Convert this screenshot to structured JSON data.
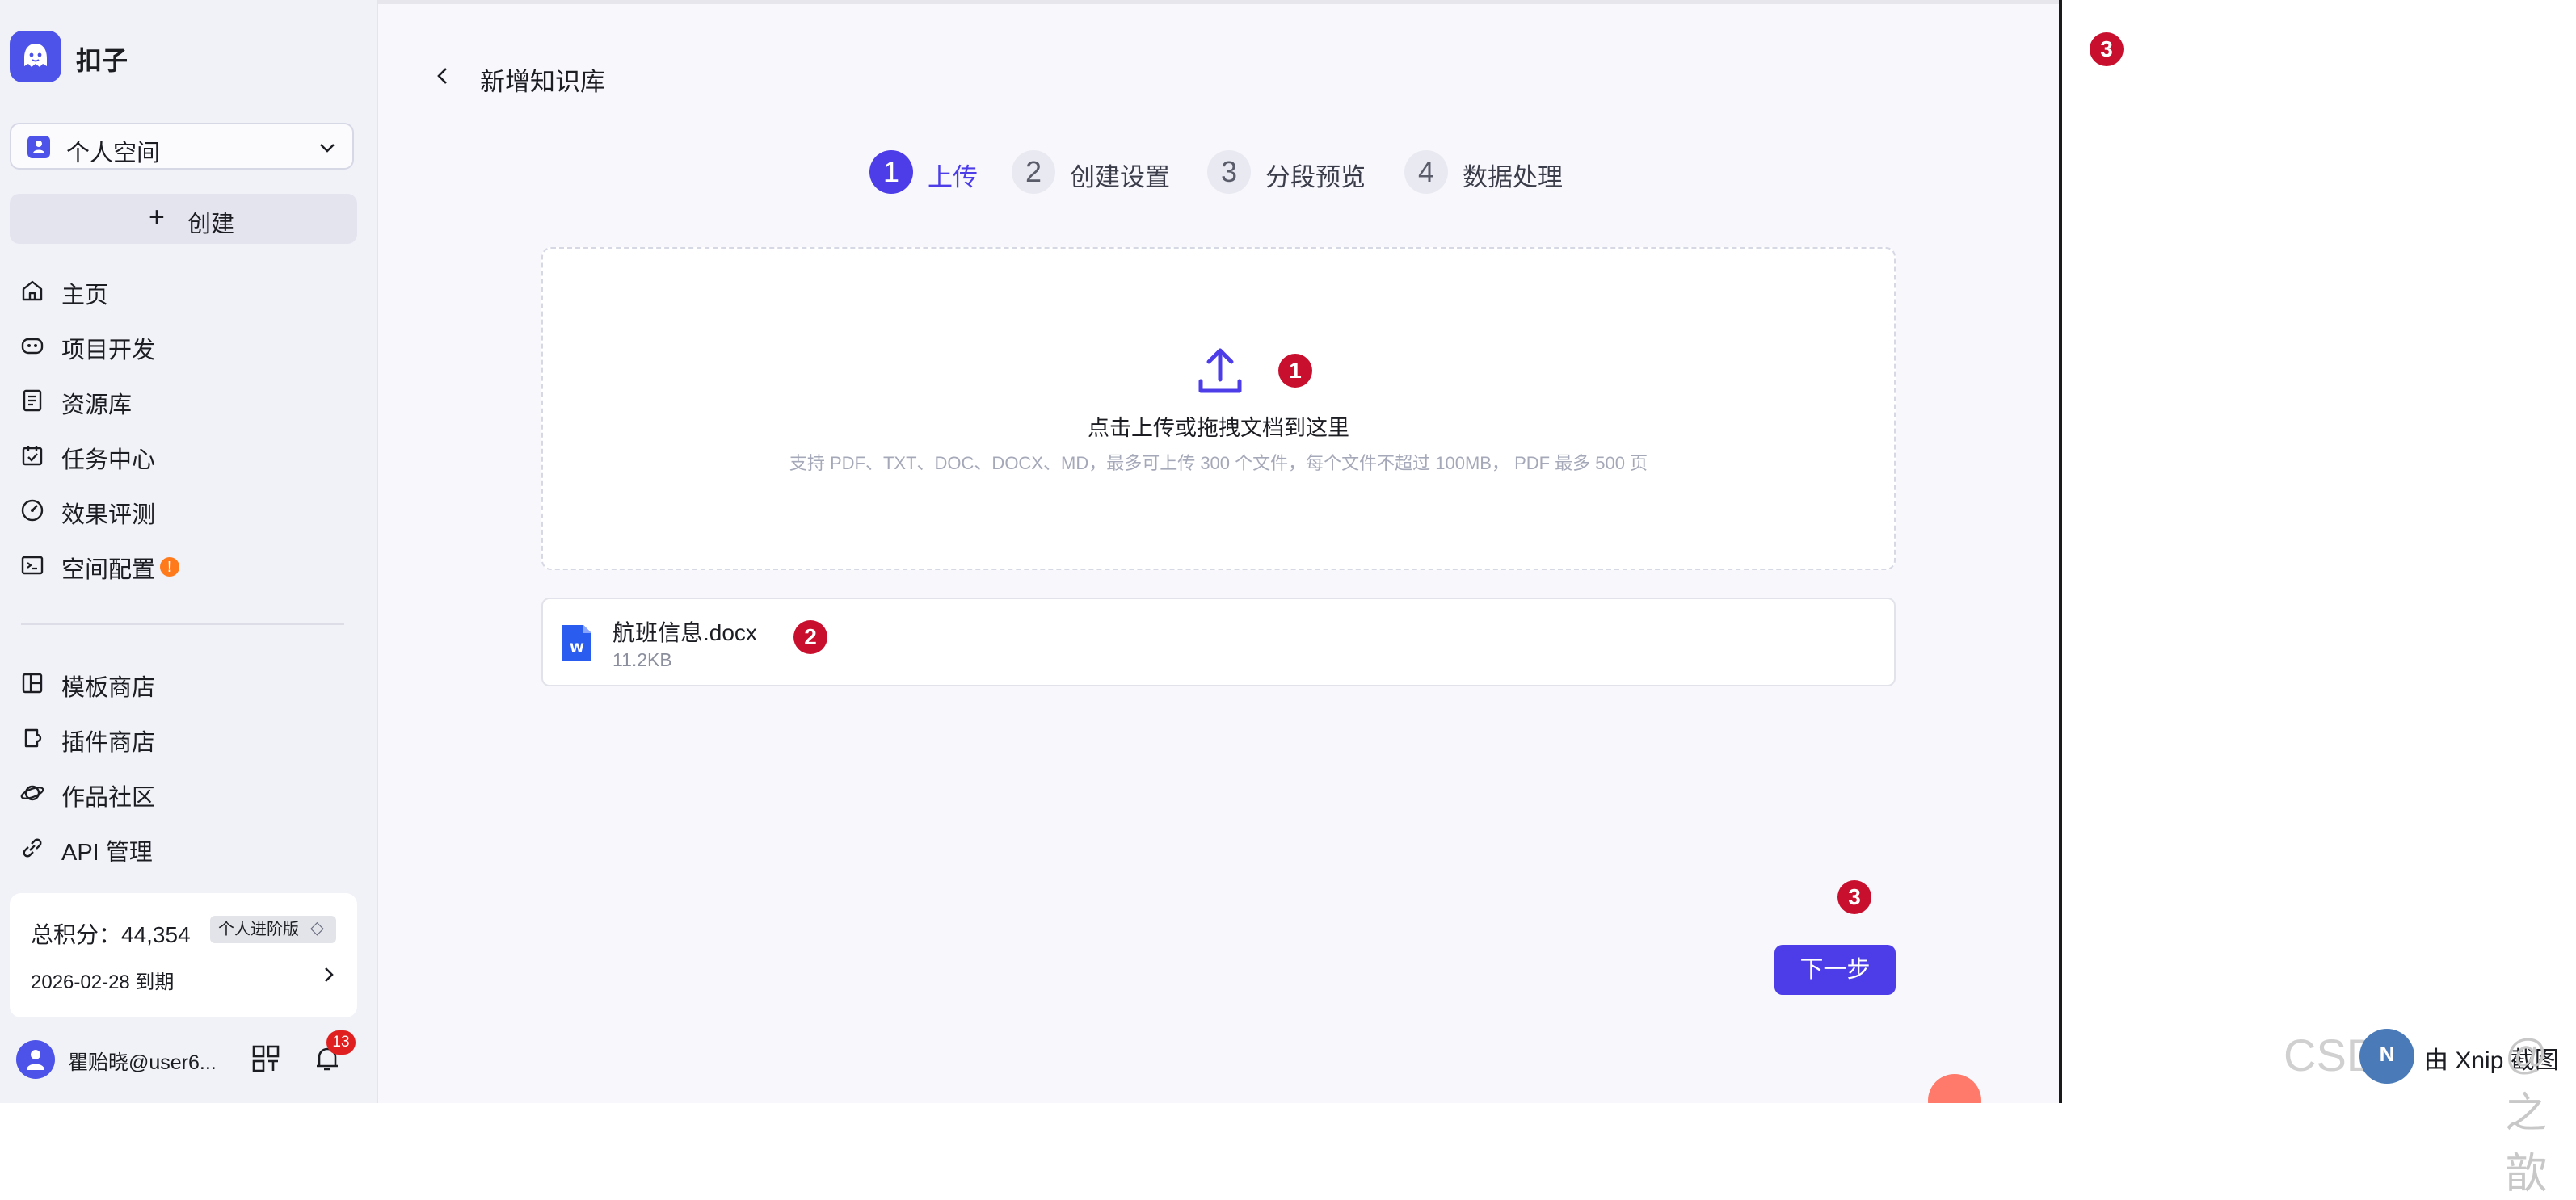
{
  "app": {
    "brand": "扣子",
    "space_selector": "个人空间",
    "create_label": "创建",
    "create_plus": "+"
  },
  "sidebar": {
    "items": [
      {
        "label": "主页",
        "icon": "home-icon"
      },
      {
        "label": "项目开发",
        "icon": "gamepad-icon"
      },
      {
        "label": "资源库",
        "icon": "library-icon"
      },
      {
        "label": "任务中心",
        "icon": "task-icon"
      },
      {
        "label": "效果评测",
        "icon": "gauge-icon"
      },
      {
        "label": "空间配置",
        "icon": "terminal-icon",
        "badge": "!"
      },
      {
        "label": "模板商店",
        "icon": "template-icon"
      },
      {
        "label": "插件商店",
        "icon": "plugin-icon"
      },
      {
        "label": "作品社区",
        "icon": "planet-icon"
      },
      {
        "label": "API 管理",
        "icon": "api-icon"
      }
    ],
    "points_label": "总积分：44,354",
    "plan_badge": "个人进阶版",
    "expiry": "2026-02-28 到期",
    "username": "瞿贻晓@user6...",
    "notification_count": "13"
  },
  "main": {
    "title": "新增知识库",
    "steps": [
      {
        "num": "1",
        "label": "上传",
        "active": true
      },
      {
        "num": "2",
        "label": "创建设置",
        "active": false
      },
      {
        "num": "3",
        "label": "分段预览",
        "active": false
      },
      {
        "num": "4",
        "label": "数据处理",
        "active": false
      }
    ],
    "upload": {
      "text": "点击上传或拖拽文档到这里",
      "hint": "支持 PDF、TXT、DOC、DOCX、MD，最多可上传 300 个文件，每个文件不超过 100MB， PDF 最多 500 页"
    },
    "file": {
      "name": "航班信息.docx",
      "size": "11.2KB"
    },
    "next_label": "下一步"
  },
  "annotations": {
    "marker1": "1",
    "marker2": "2",
    "marker3": "3"
  },
  "watermark": {
    "csdn": "CSDN",
    "circle": "N",
    "xnip": "由 Xnip 截图",
    "author": "@之歆"
  },
  "colors": {
    "accent": "#4d3de8",
    "brand": "#4d53e8",
    "marker": "#c8102e",
    "warning": "#ff7a1a"
  }
}
